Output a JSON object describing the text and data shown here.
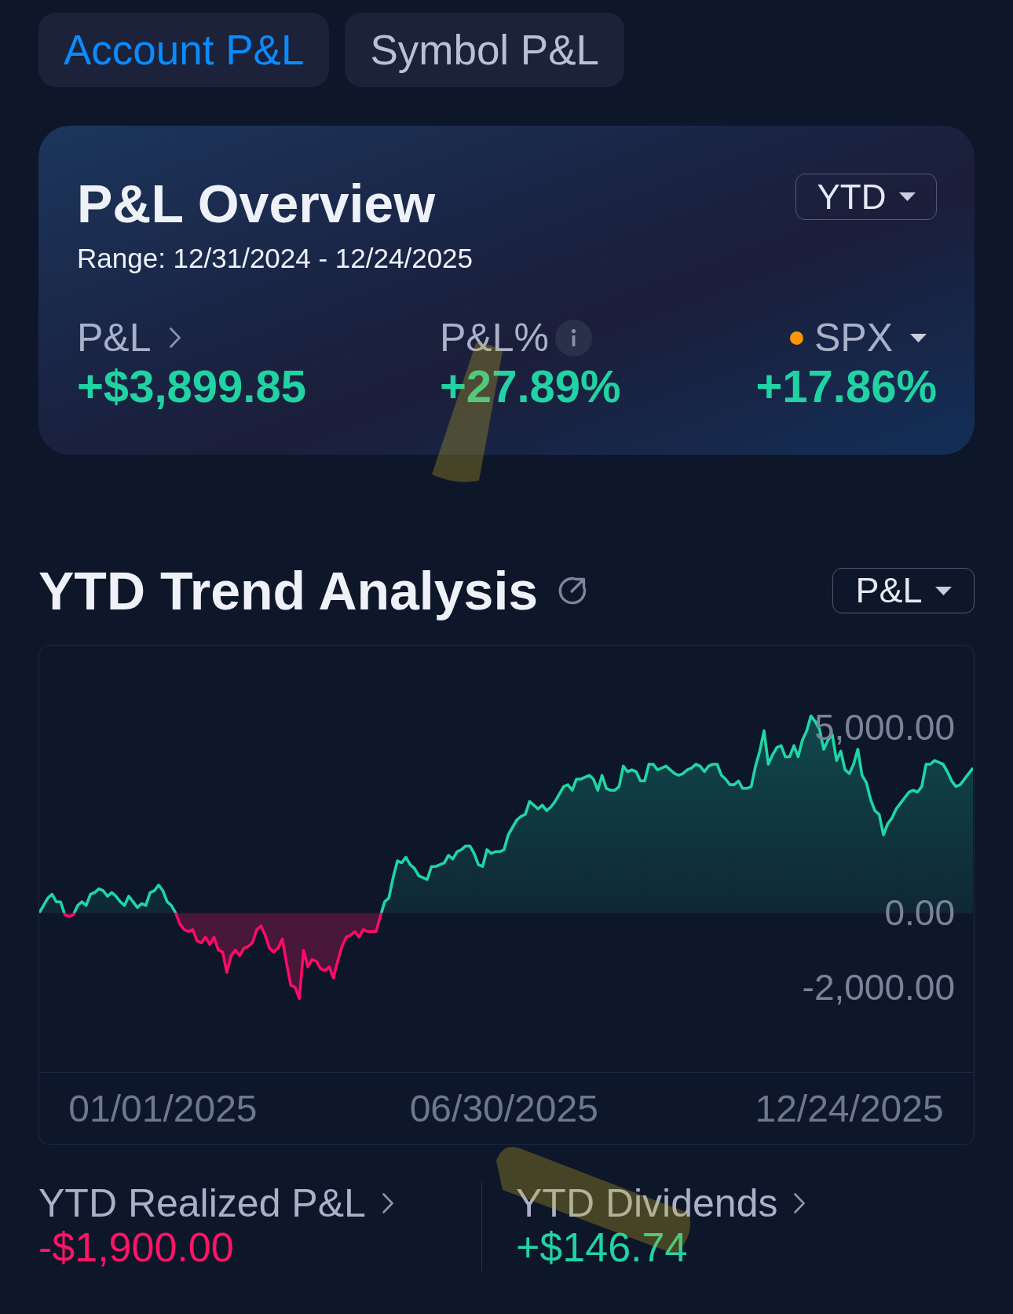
{
  "tabs": [
    {
      "label": "Account P&L",
      "selected": true
    },
    {
      "label": "Symbol P&L",
      "selected": false
    }
  ],
  "overview": {
    "title": "P&L Overview",
    "range": "Range: 12/31/2024 - 12/24/2025",
    "period_select": "YTD",
    "metrics": [
      {
        "kind": "link",
        "label": "P&L",
        "value": "+$3,899.85"
      },
      {
        "kind": "info",
        "label": "P&L%",
        "value": "+27.89%"
      },
      {
        "kind": "benchmark",
        "label": "SPX",
        "value": "+17.86%",
        "color": "#ff9500"
      }
    ]
  },
  "trend": {
    "title": "YTD Trend Analysis",
    "metric_select": "P&L",
    "chart_data": {
      "type": "area",
      "categories": [
        null,
        null,
        null,
        null,
        null,
        null,
        null,
        null,
        null,
        null,
        null,
        null,
        null,
        null,
        null,
        null,
        null,
        null,
        null,
        null,
        null,
        null,
        null,
        null,
        null,
        null,
        null,
        null,
        null,
        "01/01/2025",
        null,
        null,
        null,
        null,
        null,
        null,
        null,
        null,
        null,
        null,
        null,
        null,
        null,
        null,
        null,
        null,
        null,
        null,
        null,
        null,
        null,
        null,
        null,
        null,
        null,
        null,
        null,
        null,
        null,
        null,
        null,
        null,
        null,
        null,
        null,
        null,
        null,
        null,
        null,
        null,
        null,
        null,
        null,
        null,
        null,
        null,
        null,
        null,
        null,
        null,
        null,
        null,
        null,
        null,
        null,
        null,
        null,
        null,
        null,
        null,
        null,
        null,
        null,
        null,
        null,
        null,
        null,
        null,
        null,
        null,
        null,
        null,
        null,
        null,
        null,
        null,
        null,
        null,
        null,
        "06/30/2025",
        null,
        null,
        null,
        null,
        null,
        null,
        null,
        null,
        null,
        null,
        null,
        null,
        null,
        null,
        null,
        null,
        null,
        null,
        null,
        null,
        null,
        null,
        null,
        null,
        null,
        null,
        null,
        null,
        null,
        null,
        null,
        null,
        null,
        null,
        null,
        null,
        null,
        null,
        null,
        null,
        null,
        null,
        null,
        null,
        null,
        null,
        null,
        null,
        null,
        null,
        null,
        null,
        null,
        null,
        null,
        null,
        null,
        null,
        null,
        null,
        null,
        null,
        null,
        null,
        null,
        null,
        null,
        null,
        null,
        null,
        null,
        null,
        null,
        null,
        null,
        null,
        null,
        null,
        null,
        null,
        "12/24/2025",
        null,
        null,
        null,
        null,
        null,
        null,
        null,
        null,
        null,
        null,
        null,
        null,
        null,
        null,
        null,
        null,
        null,
        null,
        null,
        null,
        null,
        null,
        null,
        null,
        null,
        null,
        null,
        null,
        null
      ],
      "values": [
        0,
        200,
        400,
        500,
        300,
        300,
        -50,
        -100,
        -50,
        200,
        300,
        200,
        500,
        550,
        650,
        600,
        450,
        550,
        450,
        300,
        200,
        450,
        300,
        150,
        250,
        200,
        550,
        600,
        750,
        600,
        300,
        200,
        0,
        -300,
        -450,
        -500,
        -450,
        -750,
        -800,
        -650,
        -850,
        -650,
        -1000,
        -1050,
        -1600,
        -1150,
        -1000,
        -1150,
        -950,
        -900,
        -800,
        -450,
        -350,
        -600,
        -950,
        -1050,
        -950,
        -700,
        -1350,
        -1950,
        -2000,
        -2300,
        -1000,
        -1450,
        -1250,
        -1300,
        -1500,
        -1550,
        -1450,
        -1750,
        -1300,
        -900,
        -650,
        -600,
        -500,
        -650,
        -450,
        -500,
        -500,
        -500,
        -100,
        300,
        400,
        950,
        1400,
        1350,
        1500,
        1300,
        1200,
        1000,
        950,
        900,
        1250,
        1250,
        1300,
        1350,
        1550,
        1450,
        1650,
        1700,
        1800,
        1800,
        1600,
        1300,
        1250,
        1700,
        1600,
        1650,
        1650,
        1700,
        2100,
        2300,
        2500,
        2600,
        2650,
        3000,
        2900,
        2800,
        2900,
        2750,
        2850,
        3000,
        3200,
        3400,
        3450,
        3300,
        3600,
        3600,
        3650,
        3700,
        3600,
        3300,
        3700,
        3350,
        3300,
        3300,
        3400,
        3950,
        3800,
        3850,
        3800,
        3550,
        3550,
        4000,
        4000,
        3850,
        3900,
        3950,
        3850,
        3750,
        3700,
        3750,
        3850,
        3900,
        4000,
        3950,
        3800,
        3950,
        4000,
        4000,
        3700,
        3600,
        3450,
        3450,
        3550,
        3350,
        3350,
        3400,
        3950,
        4350,
        4900,
        4000,
        4250,
        4450,
        4500,
        4200,
        4200,
        4500,
        4200,
        4650,
        4900,
        5300,
        5150,
        4950,
        4400,
        4650,
        4800,
        4100,
        4350,
        3850,
        3750,
        4000,
        4400,
        3700,
        3500,
        3050,
        2750,
        2650,
        2100,
        2400,
        2550,
        2800,
        2950,
        3100,
        3250,
        3300,
        3250,
        3400,
        4000,
        4000,
        4100,
        4050,
        4000,
        3800,
        3550,
        3400,
        3450,
        3600,
        3750,
        3900
      ],
      "yticks": [
        {
          "value": 5000,
          "label": "5,000.00"
        },
        {
          "value": 0,
          "label": "0.00"
        },
        {
          "value": -2000,
          "label": "-2,000.00"
        }
      ],
      "ylim": [
        -4280,
        7190
      ]
    }
  },
  "summary": [
    {
      "label": "YTD Realized P&L",
      "value": "-$1,900.00",
      "color": "#ff1466"
    },
    {
      "label": "YTD Dividends",
      "value": "+$146.74",
      "color": "#21d3a3"
    }
  ]
}
